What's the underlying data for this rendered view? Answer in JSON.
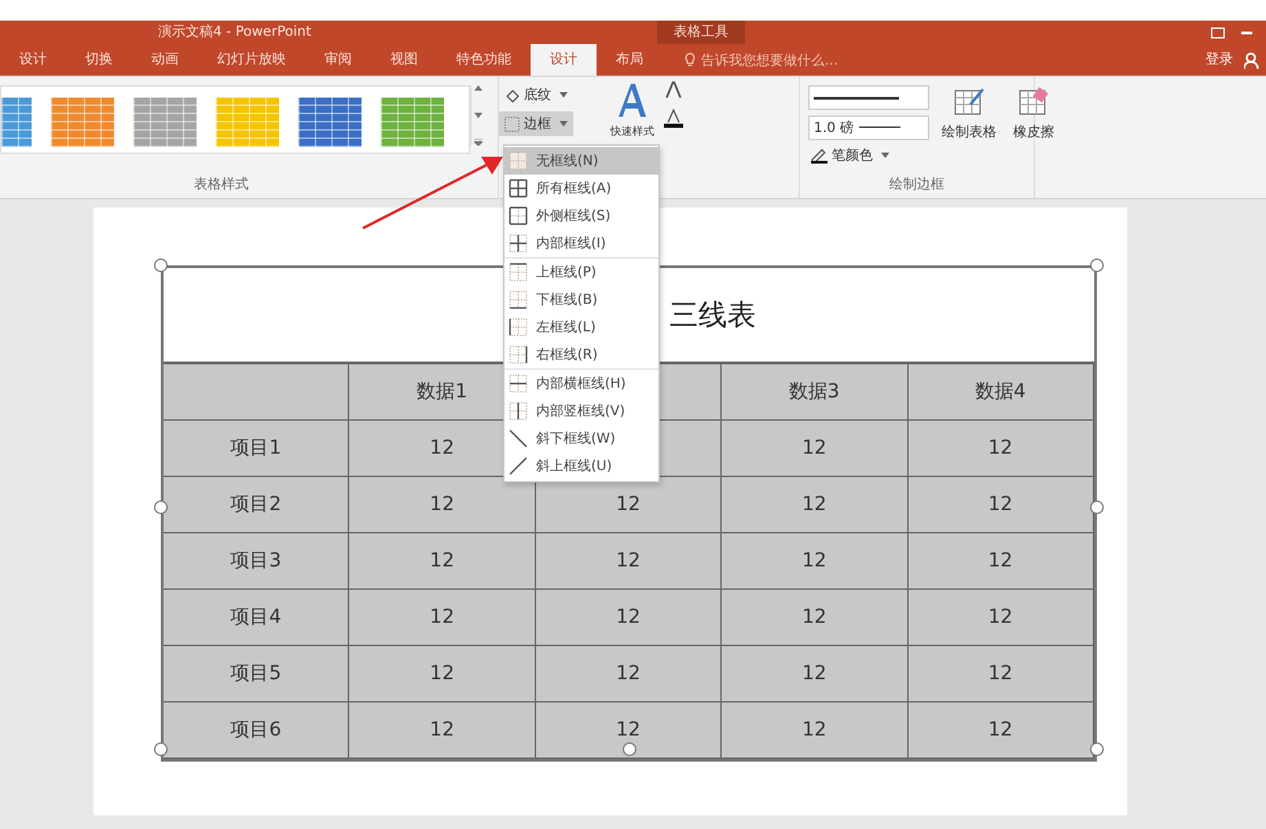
{
  "window": {
    "title": "演示文稿4 - PowerPoint",
    "context_tab": "表格工具"
  },
  "ribbon_tabs": [
    {
      "label": "设计",
      "selected": false
    },
    {
      "label": "切换",
      "selected": false
    },
    {
      "label": "动画",
      "selected": false
    },
    {
      "label": "幻灯片放映",
      "selected": false
    },
    {
      "label": "审阅",
      "selected": false
    },
    {
      "label": "视图",
      "selected": false
    },
    {
      "label": "特色功能",
      "selected": false
    },
    {
      "label": "设计",
      "selected": true
    },
    {
      "label": "布局",
      "selected": false
    }
  ],
  "tell_me": {
    "placeholder": "告诉我您想要做什么..."
  },
  "account": {
    "label": "登录"
  },
  "ribbon": {
    "table_styles": [
      {
        "color": "#4a9ad8"
      },
      {
        "color": "#f08a2c"
      },
      {
        "color": "#a5a5a5"
      },
      {
        "color": "#f5c400"
      },
      {
        "color": "#3a6fc4"
      },
      {
        "color": "#6cb33f"
      }
    ],
    "shading": "底纹",
    "borders": "边框",
    "quick_styles": "快速样式",
    "pen_weight": "1.0 磅",
    "pen_color": "笔颜色",
    "draw_table": "绘制表格",
    "eraser": "橡皮擦",
    "group_labels": [
      "表格样式",
      "绘制边框"
    ]
  },
  "border_menu": [
    {
      "label": "无框线(N)",
      "kind": "none",
      "selected": true
    },
    {
      "label": "所有框线(A)",
      "kind": "all",
      "selected": false
    },
    {
      "label": "外侧框线(S)",
      "kind": "outside",
      "selected": false
    },
    {
      "label": "内部框线(I)",
      "kind": "inside",
      "selected": false
    },
    {
      "label": "上框线(P)",
      "kind": "top",
      "selected": false
    },
    {
      "label": "下框线(B)",
      "kind": "bottom",
      "selected": false
    },
    {
      "label": "左框线(L)",
      "kind": "left",
      "selected": false
    },
    {
      "label": "右框线(R)",
      "kind": "right",
      "selected": false
    },
    {
      "label": "内部横框线(H)",
      "kind": "inside-h",
      "selected": false
    },
    {
      "label": "内部竖框线(V)",
      "kind": "inside-v",
      "selected": false
    },
    {
      "label": "斜下框线(W)",
      "kind": "diag-down",
      "selected": false
    },
    {
      "label": "斜上框线(U)",
      "kind": "diag-up",
      "selected": false
    }
  ],
  "table": {
    "title": "三线表",
    "header": {
      "column_2": "数据1",
      "column_4": "数据3",
      "column_5": "数据4"
    },
    "rows": [
      {
        "label": "项目1",
        "cells": [
          "12",
          {},
          "12",
          "12"
        ]
      },
      {
        "label": "项目2",
        "cells": [
          "12",
          "12",
          "12",
          "12"
        ]
      },
      {
        "label": "项目3",
        "cells": [
          "12",
          "12",
          "12",
          "12"
        ]
      },
      {
        "label": "项目4",
        "cells": [
          "12",
          "12",
          "12",
          "12"
        ]
      },
      {
        "label": "项目5",
        "cells": [
          "12",
          "12",
          "12",
          "12"
        ]
      },
      {
        "label": "项目6",
        "cells": [
          "12",
          "12",
          "12",
          "12"
        ]
      }
    ]
  }
}
